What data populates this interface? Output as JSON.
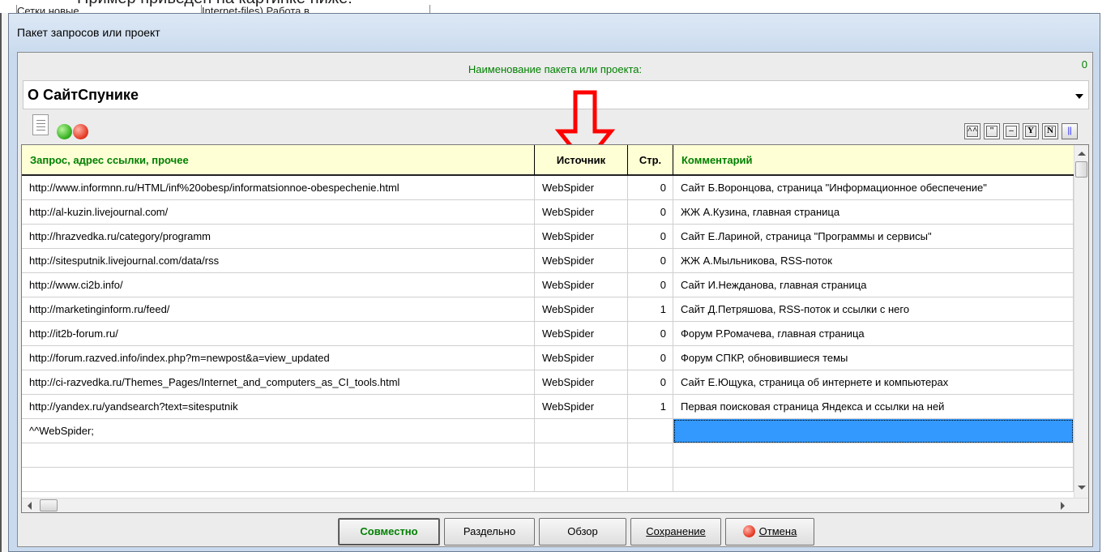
{
  "background": {
    "caption_text": "Пример приведен на картинке ниже:",
    "fragment_1": "Сетки новые",
    "fragment_2": "Internet-files) Работа в ...",
    "fragment_3": "..."
  },
  "dialog": {
    "title": "Пакет запросов или проект"
  },
  "package": {
    "label": "Наименование пакета или проекта:",
    "count": "0",
    "name": "О СайтСпунике"
  },
  "toolbar": {
    "icons": [
      "document-icon",
      "green-circle-icon",
      "red-circle-icon"
    ],
    "right_buttons": [
      {
        "name": "caret-pair-icon",
        "glyph": "^^"
      },
      {
        "name": "quote-icon",
        "glyph": "\""
      },
      {
        "name": "dash-icon",
        "glyph": "–"
      },
      {
        "name": "y-icon",
        "glyph": "Y"
      },
      {
        "name": "n-icon",
        "glyph": "N"
      },
      {
        "name": "double-bar-icon",
        "glyph": "||"
      }
    ]
  },
  "table": {
    "columns": [
      "Запрос, адрес ссылки, прочее",
      "Источник",
      "Стр.",
      "Комментарий"
    ],
    "rows": [
      {
        "url": "http://www.informnn.ru/HTML/inf%20obesp/informatsionnoe-obespechenie.html",
        "source": "WebSpider",
        "page": "0",
        "comment": "Сайт Б.Воронцова, страница \"Информационное обеспечение\""
      },
      {
        "url": "http://al-kuzin.livejournal.com/",
        "source": "WebSpider",
        "page": "0",
        "comment": "ЖЖ А.Кузина, главная страница"
      },
      {
        "url": "http://hrazvedka.ru/category/programm",
        "source": "WebSpider",
        "page": "0",
        "comment": "Сайт Е.Лариной, страница \"Программы и сервисы\""
      },
      {
        "url": "http://sitesputnik.livejournal.com/data/rss",
        "source": "WebSpider",
        "page": "0",
        "comment": "ЖЖ А.Мыльникова, RSS-поток"
      },
      {
        "url": "http://www.ci2b.info/",
        "source": "WebSpider",
        "page": "0",
        "comment": "Сайт И.Нежданова, главная страница"
      },
      {
        "url": "http://marketinginform.ru/feed/",
        "source": "WebSpider",
        "page": "1",
        "comment": "Сайт Д.Петряшова, RSS-поток и ссылки с него"
      },
      {
        "url": "http://it2b-forum.ru/",
        "source": "WebSpider",
        "page": "0",
        "comment": "Форум Р.Ромачева, главная страница"
      },
      {
        "url": "http://forum.razved.info/index.php?m=newpost&a=view_updated",
        "source": "WebSpider",
        "page": "0",
        "comment": "Форум СПКР, обновившиеся темы"
      },
      {
        "url": "http://ci-razvedka.ru/Themes_Pages/Internet_and_computers_as_CI_tools.html",
        "source": "WebSpider",
        "page": "0",
        "comment": "Сайт Е.Ющука, страница об интернете и компьютерах"
      },
      {
        "url": "http://yandex.ru/yandsearch?text=sitesputnik",
        "source": "WebSpider",
        "page": "1",
        "comment": "Первая поисковая страница Яндекса и ссылки на ней"
      },
      {
        "url": "^^WebSpider;",
        "source": "",
        "page": "",
        "comment": ""
      },
      {
        "url": "",
        "source": "",
        "page": "",
        "comment": ""
      },
      {
        "url": "",
        "source": "",
        "page": "",
        "comment": ""
      }
    ],
    "selected_row": 10,
    "selected_column": "comment"
  },
  "buttons": {
    "together": "Совместно",
    "separate": "Раздельно",
    "browse": "Обзор",
    "save": "Сохранение",
    "cancel": "Отмена"
  },
  "colors": {
    "label_green": "#008000",
    "header_bg": "#ffffd6",
    "selection": "#3399ff",
    "annotation_arrow": "#ff0000"
  }
}
